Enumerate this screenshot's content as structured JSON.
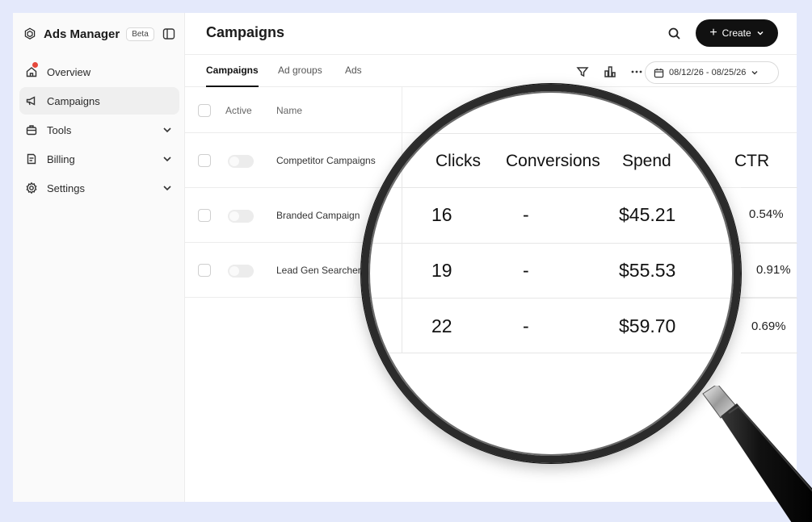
{
  "sidebar": {
    "app_title": "Ads Manager",
    "badge": "Beta",
    "items": [
      {
        "label": "Overview",
        "icon": "home-icon",
        "has_notification": true
      },
      {
        "label": "Campaigns",
        "icon": "megaphone-icon",
        "active": true
      },
      {
        "label": "Tools",
        "icon": "toolbox-icon",
        "expandable": true
      },
      {
        "label": "Billing",
        "icon": "receipt-icon",
        "expandable": true
      },
      {
        "label": "Settings",
        "icon": "gear-icon",
        "expandable": true
      }
    ]
  },
  "header": {
    "title": "Campaigns",
    "create_label": "Create"
  },
  "tabs": [
    "Campaigns",
    "Ad groups",
    "Ads"
  ],
  "date_range": "08/12/26 - 08/25/26",
  "table": {
    "columns": [
      "Active",
      "Name"
    ],
    "rows": [
      {
        "name": "Competitor Campaigns"
      },
      {
        "name": "Branded Campaign"
      },
      {
        "name": "Lead Gen Searchers"
      }
    ]
  },
  "magnified": {
    "columns": [
      "Clicks",
      "Conversions",
      "Spend",
      "CTR"
    ],
    "rows": [
      {
        "clicks": "16",
        "conversions": "-",
        "spend": "$45.21",
        "ctr": "0.54%"
      },
      {
        "clicks": "19",
        "conversions": "-",
        "spend": "$55.53",
        "ctr": "0.91%"
      },
      {
        "clicks": "22",
        "conversions": "-",
        "spend": "$59.70",
        "ctr": "0.69%"
      }
    ]
  },
  "colors": {
    "background": "#e4e9fb",
    "accent": "#111111",
    "notification": "#e5483c"
  }
}
